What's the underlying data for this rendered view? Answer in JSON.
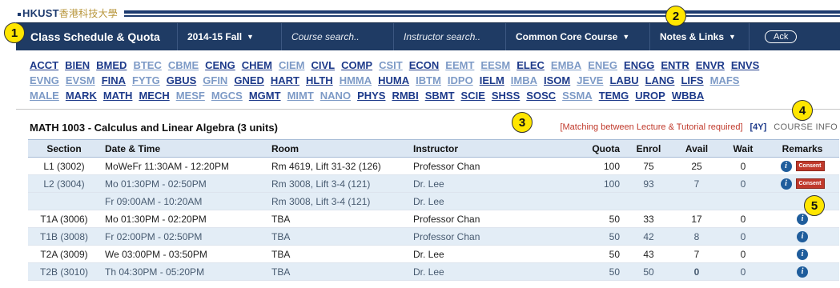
{
  "logo": {
    "en": "HKUST",
    "cn": "香港科技大學"
  },
  "navbar": {
    "title": "Class Schedule & Quota",
    "term": "2014-15 Fall",
    "course_search_placeholder": "Course search..",
    "instructor_search_placeholder": "Instructor search..",
    "common_core": "Common Core Course",
    "notes_links": "Notes & Links",
    "ack": "Ack"
  },
  "departments": {
    "rows": [
      [
        {
          "code": "ACCT",
          "dim": false
        },
        {
          "code": "BIEN",
          "dim": false
        },
        {
          "code": "BMED",
          "dim": false
        },
        {
          "code": "BTEC",
          "dim": true
        },
        {
          "code": "CBME",
          "dim": true
        },
        {
          "code": "CENG",
          "dim": false
        },
        {
          "code": "CHEM",
          "dim": false
        },
        {
          "code": "CIEM",
          "dim": true
        },
        {
          "code": "CIVL",
          "dim": false
        },
        {
          "code": "COMP",
          "dim": false
        },
        {
          "code": "CSIT",
          "dim": true
        },
        {
          "code": "ECON",
          "dim": false
        },
        {
          "code": "EEMT",
          "dim": true
        },
        {
          "code": "EESM",
          "dim": true
        },
        {
          "code": "ELEC",
          "dim": false
        },
        {
          "code": "EMBA",
          "dim": true
        },
        {
          "code": "ENEG",
          "dim": true
        },
        {
          "code": "ENGG",
          "dim": false
        },
        {
          "code": "ENTR",
          "dim": false
        },
        {
          "code": "ENVR",
          "dim": false
        },
        {
          "code": "ENVS",
          "dim": false
        }
      ],
      [
        {
          "code": "EVNG",
          "dim": true
        },
        {
          "code": "EVSM",
          "dim": true
        },
        {
          "code": "FINA",
          "dim": false
        },
        {
          "code": "FYTG",
          "dim": true
        },
        {
          "code": "GBUS",
          "dim": false
        },
        {
          "code": "GFIN",
          "dim": true
        },
        {
          "code": "GNED",
          "dim": false
        },
        {
          "code": "HART",
          "dim": false
        },
        {
          "code": "HLTH",
          "dim": false
        },
        {
          "code": "HMMA",
          "dim": true
        },
        {
          "code": "HUMA",
          "dim": false
        },
        {
          "code": "IBTM",
          "dim": true
        },
        {
          "code": "IDPO",
          "dim": true
        },
        {
          "code": "IELM",
          "dim": false
        },
        {
          "code": "IMBA",
          "dim": true
        },
        {
          "code": "ISOM",
          "dim": false
        },
        {
          "code": "JEVE",
          "dim": true
        },
        {
          "code": "LABU",
          "dim": false
        },
        {
          "code": "LANG",
          "dim": false
        },
        {
          "code": "LIFS",
          "dim": false
        },
        {
          "code": "MAFS",
          "dim": true
        }
      ],
      [
        {
          "code": "MALE",
          "dim": true
        },
        {
          "code": "MARK",
          "dim": false
        },
        {
          "code": "MATH",
          "dim": false
        },
        {
          "code": "MECH",
          "dim": false
        },
        {
          "code": "MESF",
          "dim": true
        },
        {
          "code": "MGCS",
          "dim": true
        },
        {
          "code": "MGMT",
          "dim": false
        },
        {
          "code": "MIMT",
          "dim": true
        },
        {
          "code": "NANO",
          "dim": true
        },
        {
          "code": "PHYS",
          "dim": false
        },
        {
          "code": "RMBI",
          "dim": false
        },
        {
          "code": "SBMT",
          "dim": false
        },
        {
          "code": "SCIE",
          "dim": false
        },
        {
          "code": "SHSS",
          "dim": false
        },
        {
          "code": "SOSC",
          "dim": false
        },
        {
          "code": "SSMA",
          "dim": true
        },
        {
          "code": "TEMG",
          "dim": false
        },
        {
          "code": "UROP",
          "dim": false
        },
        {
          "code": "WBBA",
          "dim": false
        }
      ]
    ]
  },
  "course": {
    "title": "MATH 1003 - Calculus and Linear Algebra (3 units)",
    "matching_note": "[Matching between Lecture & Tutorial required]",
    "year_tag": "[4Y]",
    "course_info": "COURSE INFO"
  },
  "table": {
    "headers": [
      "Section",
      "Date & Time",
      "Room",
      "Instructor",
      "Quota",
      "Enrol",
      "Avail",
      "Wait",
      "Remarks"
    ],
    "rows": [
      {
        "section": "L1 (3002)",
        "datetime": "MoWeFr 11:30AM - 12:20PM",
        "room": "Rm 4619, Lift 31-32 (126)",
        "instructor": "Professor Chan",
        "quota": "100",
        "enrol": "75",
        "avail": "25",
        "wait": "0",
        "info": true,
        "consent": true,
        "alt": false,
        "avail_red": false
      },
      {
        "section": "L2 (3004)",
        "datetime": "Mo 01:30PM - 02:50PM",
        "room": "Rm 3008, Lift 3-4 (121)",
        "instructor": "Dr. Lee",
        "quota": "100",
        "enrol": "93",
        "avail": "7",
        "wait": "0",
        "info": true,
        "consent": true,
        "alt": true,
        "avail_red": false
      },
      {
        "section": "",
        "datetime": "Fr 09:00AM - 10:20AM",
        "room": "Rm 3008, Lift 3-4 (121)",
        "instructor": "Dr. Lee",
        "quota": "",
        "enrol": "",
        "avail": "",
        "wait": "",
        "info": false,
        "consent": false,
        "alt": true,
        "avail_red": false
      },
      {
        "section": "T1A (3006)",
        "datetime": "Mo 01:30PM - 02:20PM",
        "room": "TBA",
        "instructor": "Professor Chan",
        "quota": "50",
        "enrol": "33",
        "avail": "17",
        "wait": "0",
        "info": true,
        "consent": false,
        "alt": false,
        "avail_red": false
      },
      {
        "section": "T1B (3008)",
        "datetime": "Fr 02:00PM - 02:50PM",
        "room": "TBA",
        "instructor": "Professor Chan",
        "quota": "50",
        "enrol": "42",
        "avail": "8",
        "wait": "0",
        "info": true,
        "consent": false,
        "alt": true,
        "avail_red": false
      },
      {
        "section": "T2A (3009)",
        "datetime": "We 03:00PM - 03:50PM",
        "room": "TBA",
        "instructor": "Dr. Lee",
        "quota": "50",
        "enrol": "43",
        "avail": "7",
        "wait": "0",
        "info": true,
        "consent": false,
        "alt": false,
        "avail_red": false
      },
      {
        "section": "T2B (3010)",
        "datetime": "Th 04:30PM - 05:20PM",
        "room": "TBA",
        "instructor": "Dr. Lee",
        "quota": "50",
        "enrol": "50",
        "avail": "0",
        "wait": "0",
        "info": true,
        "consent": false,
        "alt": true,
        "avail_red": true
      }
    ],
    "info_glyph": "i",
    "consent_label": "Consent"
  },
  "callouts": [
    "1",
    "2",
    "3",
    "4",
    "5"
  ],
  "colors": {
    "navbar": "#1f3b64",
    "link": "#1d3a8a",
    "link_dim": "#7d9ac6",
    "header_bg": "#dce7f3",
    "alt_row": "#e3edf6",
    "consent": "#c0392b",
    "callout": "#ffe600"
  }
}
